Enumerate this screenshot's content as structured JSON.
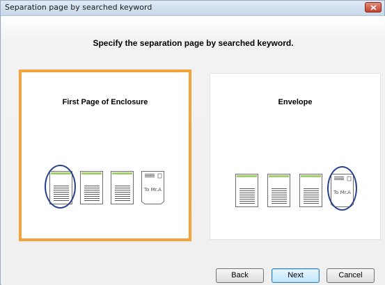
{
  "window": {
    "title": "Separation page by searched keyword"
  },
  "dialog": {
    "heading": "Specify the separation page by searched keyword."
  },
  "options": [
    {
      "label": "First Page of Enclosure",
      "selected": true,
      "circled_index": 0
    },
    {
      "label": "Envelope",
      "selected": false,
      "circled_index": 3
    }
  ],
  "envelope_text": "To Mr.A",
  "buttons": {
    "back": "Back",
    "next": "Next",
    "cancel": "Cancel"
  },
  "colors": {
    "selection_border": "#f4a23a",
    "highlight_ring": "#283f8f",
    "page_header_bar": "#9fd06a",
    "close_button": "#c2432e"
  },
  "icons": [
    "close-icon",
    "document-page-icon",
    "envelope-icon"
  ]
}
